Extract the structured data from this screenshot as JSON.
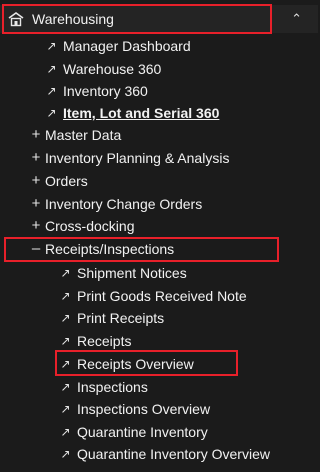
{
  "header": {
    "title": "Warehousing",
    "home_icon": "warehouse-home-icon",
    "chevron_icon": "chevron-up-icon"
  },
  "links_level1": [
    {
      "label": "Manager Dashboard",
      "icon": "external-link-icon"
    },
    {
      "label": "Warehouse 360",
      "icon": "external-link-icon"
    },
    {
      "label": "Inventory 360",
      "icon": "external-link-icon"
    },
    {
      "label": "Item, Lot and Serial 360",
      "icon": "external-link-icon"
    }
  ],
  "groups": [
    {
      "label": "Master Data",
      "toggle": "+"
    },
    {
      "label": "Inventory Planning & Analysis",
      "toggle": "+"
    },
    {
      "label": "Orders",
      "toggle": "+"
    },
    {
      "label": "Inventory Change Orders",
      "toggle": "+"
    },
    {
      "label": "Cross-docking",
      "toggle": "+"
    },
    {
      "label": "Receipts/Inspections",
      "toggle": "–"
    }
  ],
  "receipts_children": [
    {
      "label": "Shipment Notices"
    },
    {
      "label": "Print Goods Received Note"
    },
    {
      "label": "Print Receipts"
    },
    {
      "label": "Receipts"
    },
    {
      "label": "Receipts Overview"
    },
    {
      "label": "Inspections"
    },
    {
      "label": "Inspections Overview"
    },
    {
      "label": "Quarantine Inventory"
    },
    {
      "label": "Quarantine Inventory Overview"
    }
  ],
  "external_glyph": "↗",
  "colors": {
    "background": "#1b1b1b",
    "highlight": "#e8202a",
    "text": "#f2f2f2"
  }
}
